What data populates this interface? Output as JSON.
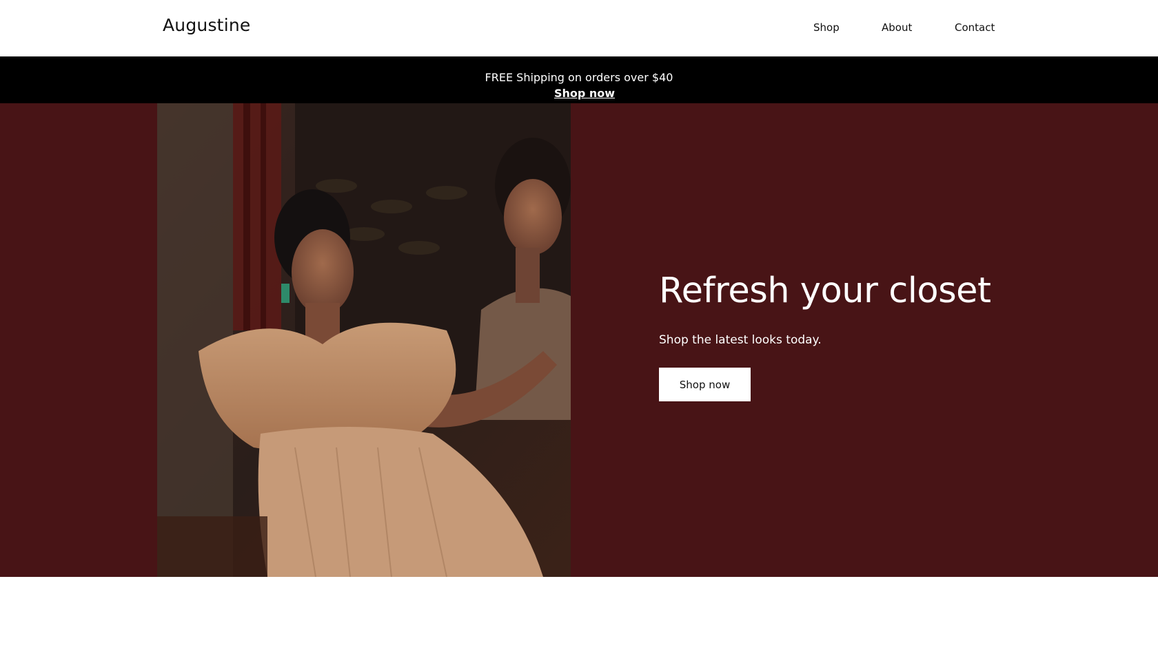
{
  "header": {
    "logo": "Augustine",
    "nav": {
      "shop": "Shop",
      "about": "About",
      "contact": "Contact"
    }
  },
  "promo": {
    "text": "FREE Shipping on orders over $40",
    "link": "Shop now"
  },
  "hero": {
    "title": "Refresh your closet",
    "subtitle": "Shop the latest looks today.",
    "button": "Shop now",
    "background_color": "#481416",
    "image": "woman-in-tulle-dress-photo"
  }
}
